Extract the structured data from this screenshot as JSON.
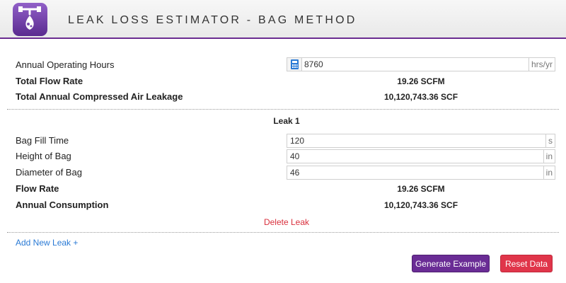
{
  "header": {
    "title": "LEAK LOSS ESTIMATOR - BAG METHOD",
    "logo_icon": "leak-bag-icon"
  },
  "summary": {
    "operating_hours_label": "Annual Operating Hours",
    "operating_hours_value": "8760",
    "operating_hours_unit": "hrs/yr",
    "total_flow_label": "Total Flow Rate",
    "total_flow_value": "19.26 SCFM",
    "total_leakage_label": "Total Annual Compressed Air Leakage",
    "total_leakage_value": "10,120,743.36 SCF"
  },
  "leak": {
    "title": "Leak 1",
    "fill_time_label": "Bag Fill Time",
    "fill_time_value": "120",
    "fill_time_unit": "s",
    "height_label": "Height of Bag",
    "height_value": "40",
    "height_unit": "in",
    "diameter_label": "Diameter of Bag",
    "diameter_value": "46",
    "diameter_unit": "in",
    "flow_rate_label": "Flow Rate",
    "flow_rate_value": "19.26 SCFM",
    "consumption_label": "Annual Consumption",
    "consumption_value": "10,120,743.36 SCF",
    "delete_label": "Delete Leak"
  },
  "actions": {
    "add_leak_label": "Add New Leak +",
    "generate_label": "Generate Example",
    "reset_label": "Reset Data"
  },
  "colors": {
    "accent": "#6a2c95",
    "danger": "#e0354a",
    "link": "#2a7ad5"
  }
}
